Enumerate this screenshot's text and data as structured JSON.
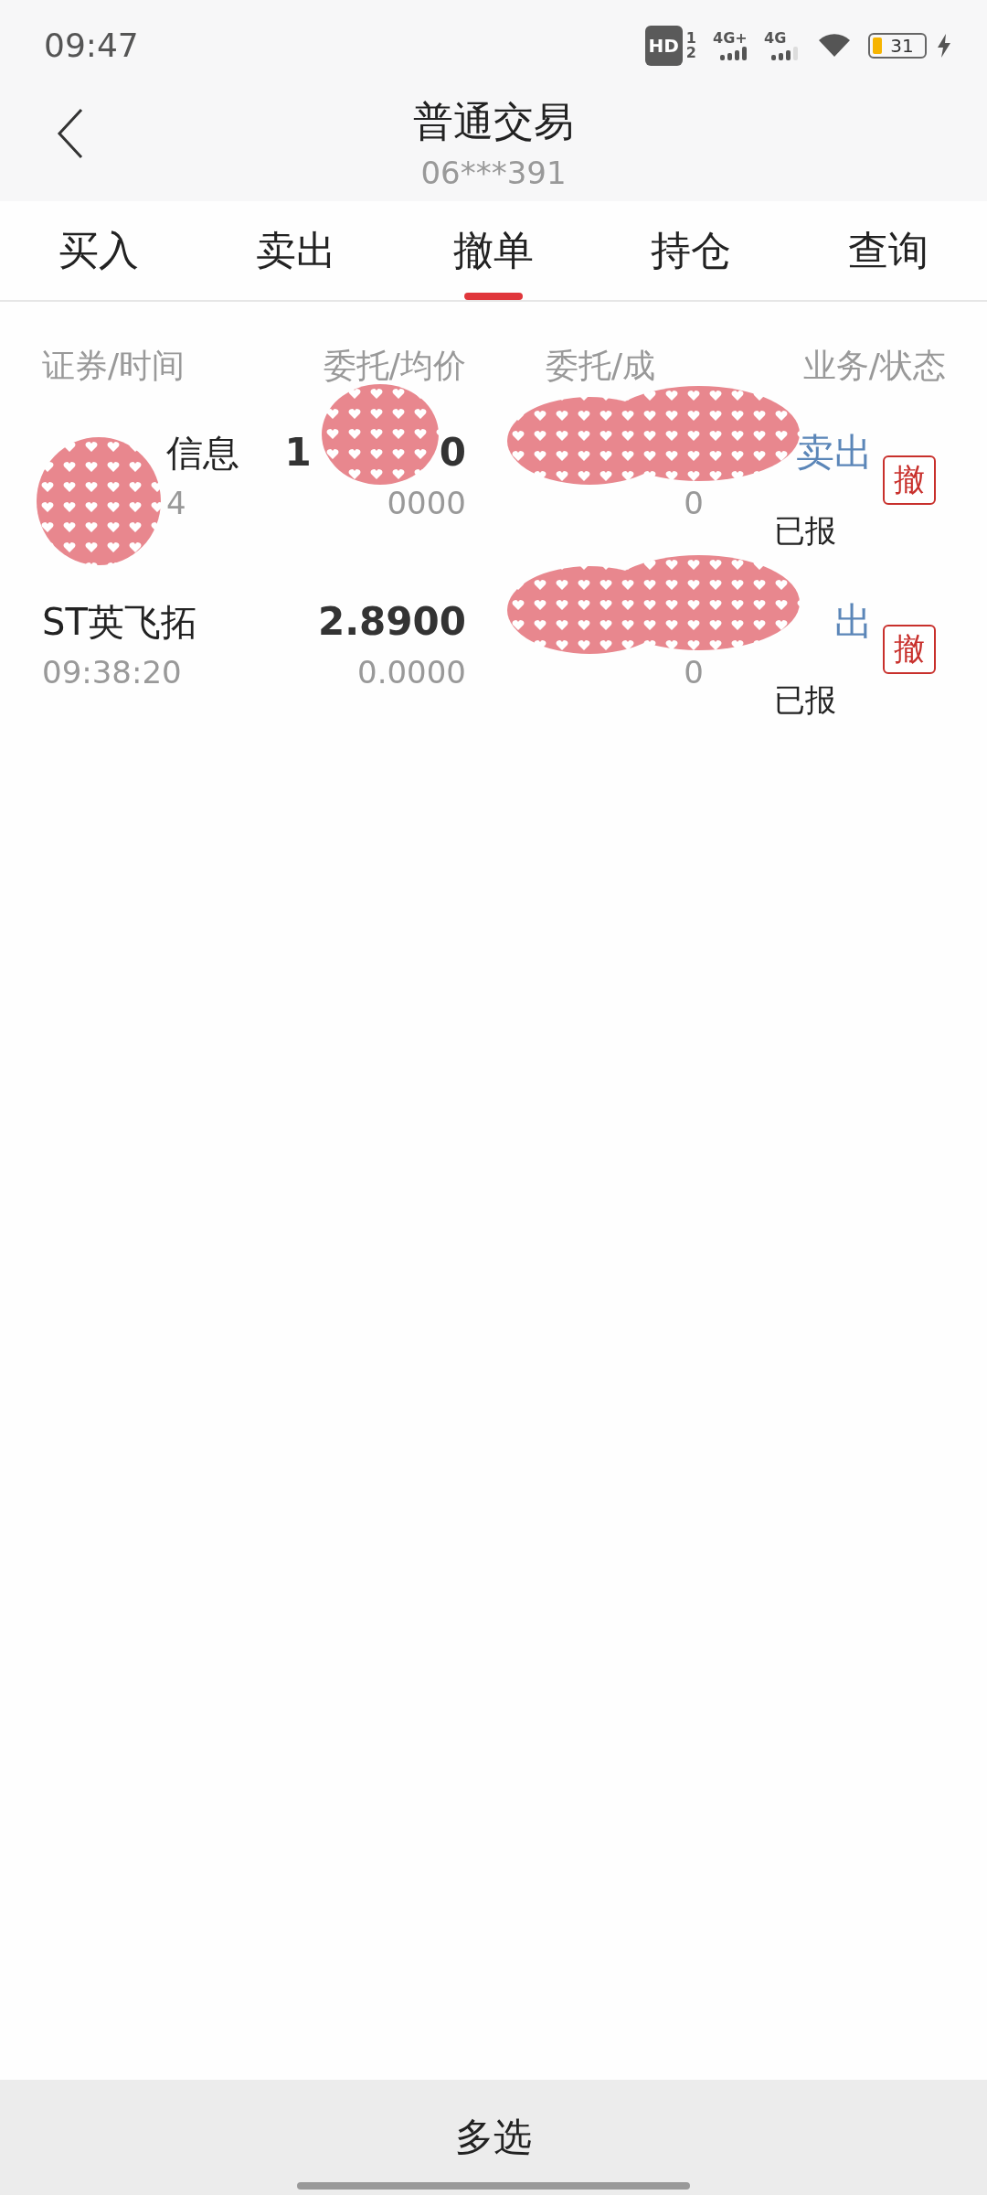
{
  "status_bar": {
    "time": "09:47",
    "hd": "HD",
    "sims": [
      "1",
      "2"
    ],
    "networks": [
      "4G+",
      "4G"
    ],
    "battery": "31"
  },
  "header": {
    "title": "普通交易",
    "account": "06***391"
  },
  "tabs": [
    {
      "label": "买入",
      "selected": false
    },
    {
      "label": "卖出",
      "selected": false
    },
    {
      "label": "撤单",
      "selected": true
    },
    {
      "label": "持仓",
      "selected": false
    },
    {
      "label": "查询",
      "selected": false
    }
  ],
  "columns": [
    "证券/时间",
    "委托/均价",
    "委托/成",
    "业务/状态"
  ],
  "orders": [
    {
      "name": "信息",
      "time": "4",
      "price_parts": [
        "1",
        "0"
      ],
      "avg_price": "0000",
      "filled": "0",
      "side": "卖出",
      "status": "已报",
      "cancel": "撤",
      "name_covered": true,
      "price_covered": true,
      "fill_covered": true
    },
    {
      "name": "ST英飞拓",
      "time": "09:38:20",
      "price_parts": [
        "2.8900"
      ],
      "avg_price": "0.0000",
      "filled": "0",
      "side": "出",
      "status": "已报",
      "cancel": "撤",
      "name_covered": false,
      "price_covered": false,
      "fill_covered": true
    }
  ],
  "bottom_button": "多选"
}
